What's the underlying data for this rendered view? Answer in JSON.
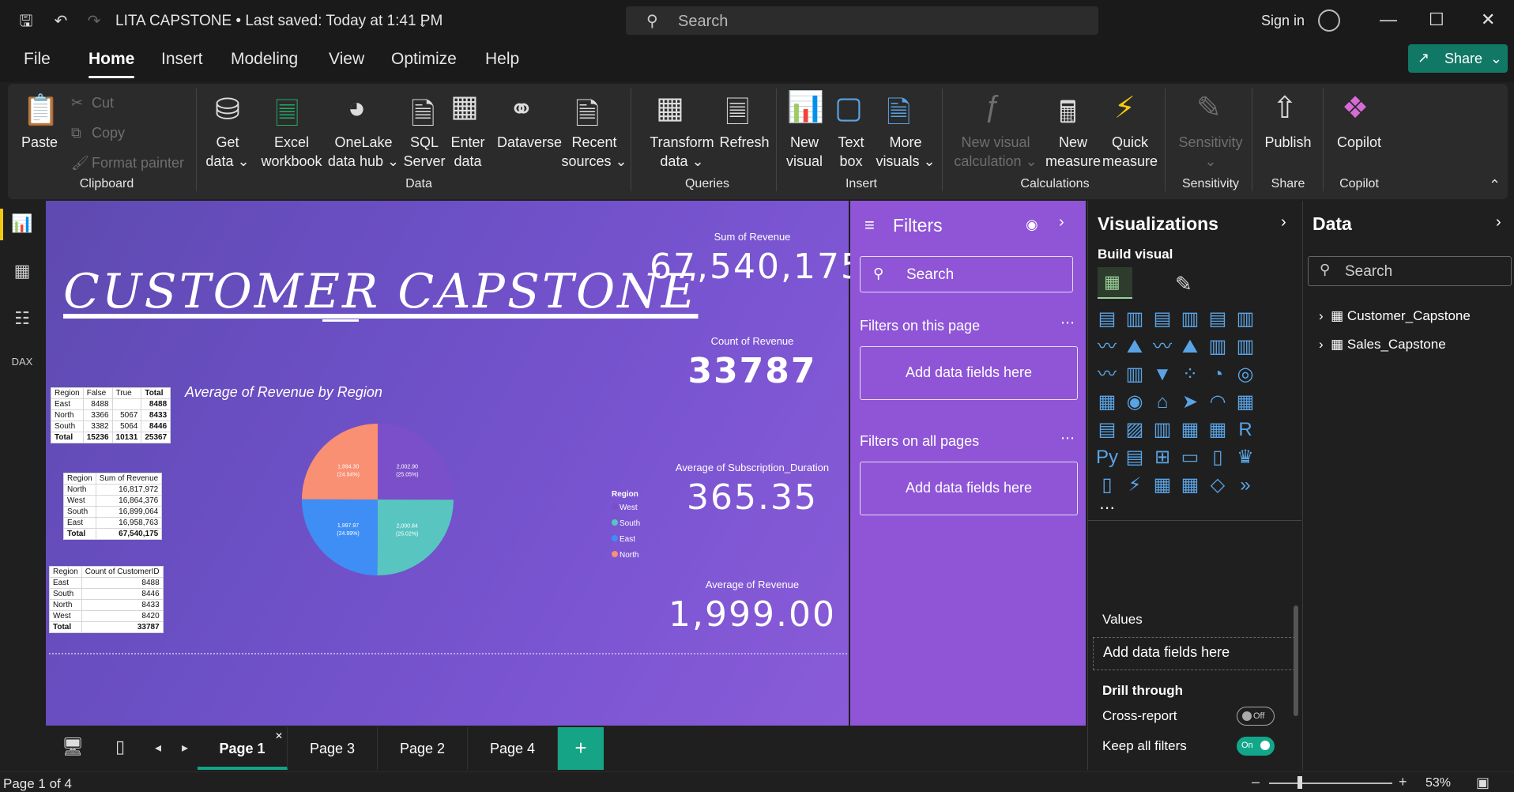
{
  "titlebar": {
    "title": "LITA CAPSTONE • Last saved: Today at 1:41 PM",
    "search_placeholder": "Search",
    "sign_in": "Sign in"
  },
  "menu": [
    "File",
    "Home",
    "Insert",
    "Modeling",
    "View",
    "Optimize",
    "Help"
  ],
  "share_label": "Share",
  "ribbon": {
    "paste": "Paste",
    "cut": "Cut",
    "copy": "Copy",
    "format_painter": "Format painter",
    "clipboard_group": "Clipboard",
    "get_data": [
      "Get",
      "data"
    ],
    "excel": [
      "Excel",
      "workbook"
    ],
    "onelake": [
      "OneLake",
      "data hub"
    ],
    "sql": [
      "SQL",
      "Server"
    ],
    "enter_data": [
      "Enter",
      "data"
    ],
    "dataverse": "Dataverse",
    "recent": [
      "Recent",
      "sources"
    ],
    "data_group": "Data",
    "transform": [
      "Transform",
      "data"
    ],
    "refresh": "Refresh",
    "queries_group": "Queries",
    "new_visual": [
      "New",
      "visual"
    ],
    "text_box": [
      "Text",
      "box"
    ],
    "more_visuals": [
      "More",
      "visuals"
    ],
    "insert_group": "Insert",
    "new_visual_calc": [
      "New visual",
      "calculation"
    ],
    "new_measure": [
      "New",
      "measure"
    ],
    "quick_measure": [
      "Quick",
      "measure"
    ],
    "calc_group": "Calculations",
    "sensitivity": "Sensitivity",
    "sensitivity_group": "Sensitivity",
    "publish": "Publish",
    "share_group": "Share",
    "copilot": "Copilot",
    "copilot_group": "Copilot"
  },
  "report": {
    "title": "CUSTOMER  CAPSTONE",
    "cards": [
      {
        "label": "Sum of Revenue",
        "value": "67,540,175"
      },
      {
        "label": "Count of Revenue",
        "value": "33787"
      },
      {
        "label": "Average of Subscription_Duration",
        "value": "365.35"
      },
      {
        "label": "Average of Revenue",
        "value": "1,999.00"
      }
    ],
    "table1": {
      "headers": [
        "Region",
        "False",
        "True",
        "Total"
      ],
      "rows": [
        [
          "East",
          "8488",
          "",
          "8488"
        ],
        [
          "North",
          "3366",
          "5067",
          "8433"
        ],
        [
          "South",
          "3382",
          "5064",
          "8446"
        ],
        [
          "Total",
          "15236",
          "10131",
          "25367"
        ]
      ]
    },
    "table2": {
      "headers": [
        "Region",
        "Sum of Revenue"
      ],
      "rows": [
        [
          "North",
          "16,817,972"
        ],
        [
          "West",
          "16,864,376"
        ],
        [
          "South",
          "16,899,064"
        ],
        [
          "East",
          "16,958,763"
        ],
        [
          "Total",
          "67,540,175"
        ]
      ]
    },
    "table3": {
      "headers": [
        "Region",
        "Count of CustomerID"
      ],
      "rows": [
        [
          "East",
          "8488"
        ],
        [
          "South",
          "8446"
        ],
        [
          "North",
          "8433"
        ],
        [
          "West",
          "8420"
        ],
        [
          "Total",
          "33787"
        ]
      ]
    }
  },
  "chart_data": {
    "type": "pie",
    "title": "Average of Revenue by Region",
    "legend_title": "Region",
    "legend_placement": "right",
    "slices": [
      {
        "name": "West",
        "value": 2002.9,
        "label": "2,002.90",
        "pct": "(25.05%)",
        "color": "#7b4fc9"
      },
      {
        "name": "South",
        "value": 2000.84,
        "label": "2,000.84",
        "pct": "(25.02%)",
        "color": "#58c5c0"
      },
      {
        "name": "East",
        "value": 1997.97,
        "label": "1,997.97",
        "pct": "(24.99%)",
        "color": "#3f8ef5"
      },
      {
        "name": "North",
        "value": 1994.3,
        "label": "1,994.30",
        "pct": "(24.94%)",
        "color": "#f98f73"
      }
    ]
  },
  "filters": {
    "title": "Filters",
    "search": "Search",
    "on_page": "Filters on this page",
    "on_all": "Filters on all pages",
    "add": "Add data fields here"
  },
  "viz": {
    "title": "Visualizations",
    "build": "Build visual",
    "values": "Values",
    "add": "Add data fields here",
    "drill": "Drill through",
    "cross": "Cross-report",
    "cross_state": "Off",
    "keep": "Keep all filters",
    "keep_state": "On"
  },
  "data_pane": {
    "title": "Data",
    "search": "Search",
    "tables": [
      "Customer_Capstone",
      "Sales_Capstone"
    ]
  },
  "pages": [
    "Page 1",
    "Page 3",
    "Page 2",
    "Page 4"
  ],
  "status": {
    "page": "Page 1 of 4",
    "zoom": "53%"
  }
}
